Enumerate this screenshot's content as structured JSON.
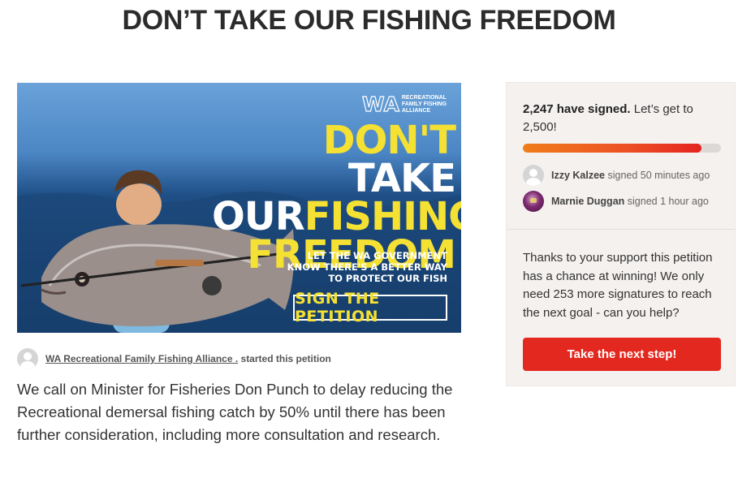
{
  "page": {
    "title": "DON’T TAKE OUR FISHING FREEDOM"
  },
  "hero": {
    "logo_mark": "WA",
    "logo_text": "RECREATIONAL FAMILY FISHING ALLIANCE",
    "headline_line1_a": "DON'T",
    "headline_line1_b": "TAKE",
    "headline_line2_a": "OUR",
    "headline_line2_b": "FISHING",
    "headline_line3": "FREEDOM",
    "sub_line1": "LET THE WA GOVERNMENT",
    "sub_line2": "KNOW THERE'S A BETTER WAY",
    "sub_line3": "TO PROTECT OUR FISH",
    "sign_text": "SIGN THE PETITION",
    "colors": {
      "yellow": "#f5e133",
      "ocean": "#1f4f86"
    }
  },
  "starter": {
    "name": "WA Recreational Family Fishing Alliance .",
    "action": "started this petition"
  },
  "description": "We call on Minister for Fisheries Don Punch to delay reducing the Recreational demersal fishing catch by 50% until there has been further consideration, including more consultation and research.",
  "sidebar": {
    "signed_count": "2,247 have signed.",
    "goal_text": "Let’s get to 2,500!",
    "progress_fraction": 0.9,
    "signers": [
      {
        "name": "Izzy Kalzee",
        "action": "signed 50 minutes ago"
      },
      {
        "name": "Marnie Duggan",
        "action": "signed 1 hour ago"
      }
    ],
    "support_text": "Thanks to your support this petition has a chance at winning! We only need 253 more signatures to reach the next goal - can you help?",
    "cta_label": "Take the next step!",
    "colors": {
      "cta": "#e3291f",
      "panel": "#f4f1ef"
    }
  }
}
